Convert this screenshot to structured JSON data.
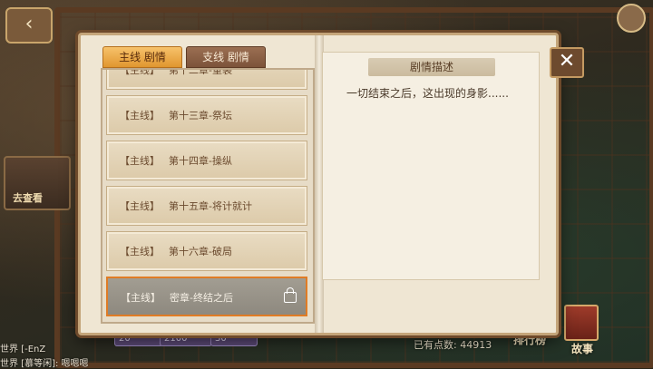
{
  "tabs": [
    {
      "label": "主线 剧情",
      "active": true
    },
    {
      "label": "支线 剧情",
      "active": false
    }
  ],
  "chapters": [
    {
      "tag": "【主线】",
      "title": "第十二章-重袭",
      "locked": false,
      "selected": false
    },
    {
      "tag": "【主线】",
      "title": "第十三章-祭坛",
      "locked": false,
      "selected": false
    },
    {
      "tag": "【主线】",
      "title": "第十四章-操纵",
      "locked": false,
      "selected": false
    },
    {
      "tag": "【主线】",
      "title": "第十五章-将计就计",
      "locked": false,
      "selected": false
    },
    {
      "tag": "【主线】",
      "title": "第十六章-破局",
      "locked": false,
      "selected": false
    },
    {
      "tag": "【主线】",
      "title": "密章-终结之后",
      "locked": true,
      "selected": true
    }
  ],
  "description": {
    "title": "剧情描述",
    "text": "一切结束之后，这出现的身影......"
  },
  "background": {
    "left_sign": "去查看",
    "chat": [
      "世界 [-EnZ",
      "世界 [慕等闲]: 嗯嗯嗯"
    ],
    "resources": [
      "20",
      "2100",
      "30"
    ],
    "points": "已有点数: 44913",
    "ranking_label": "排行榜",
    "story_label": "故事"
  },
  "close_icon": "close-icon",
  "accent_color": "#e07c25"
}
